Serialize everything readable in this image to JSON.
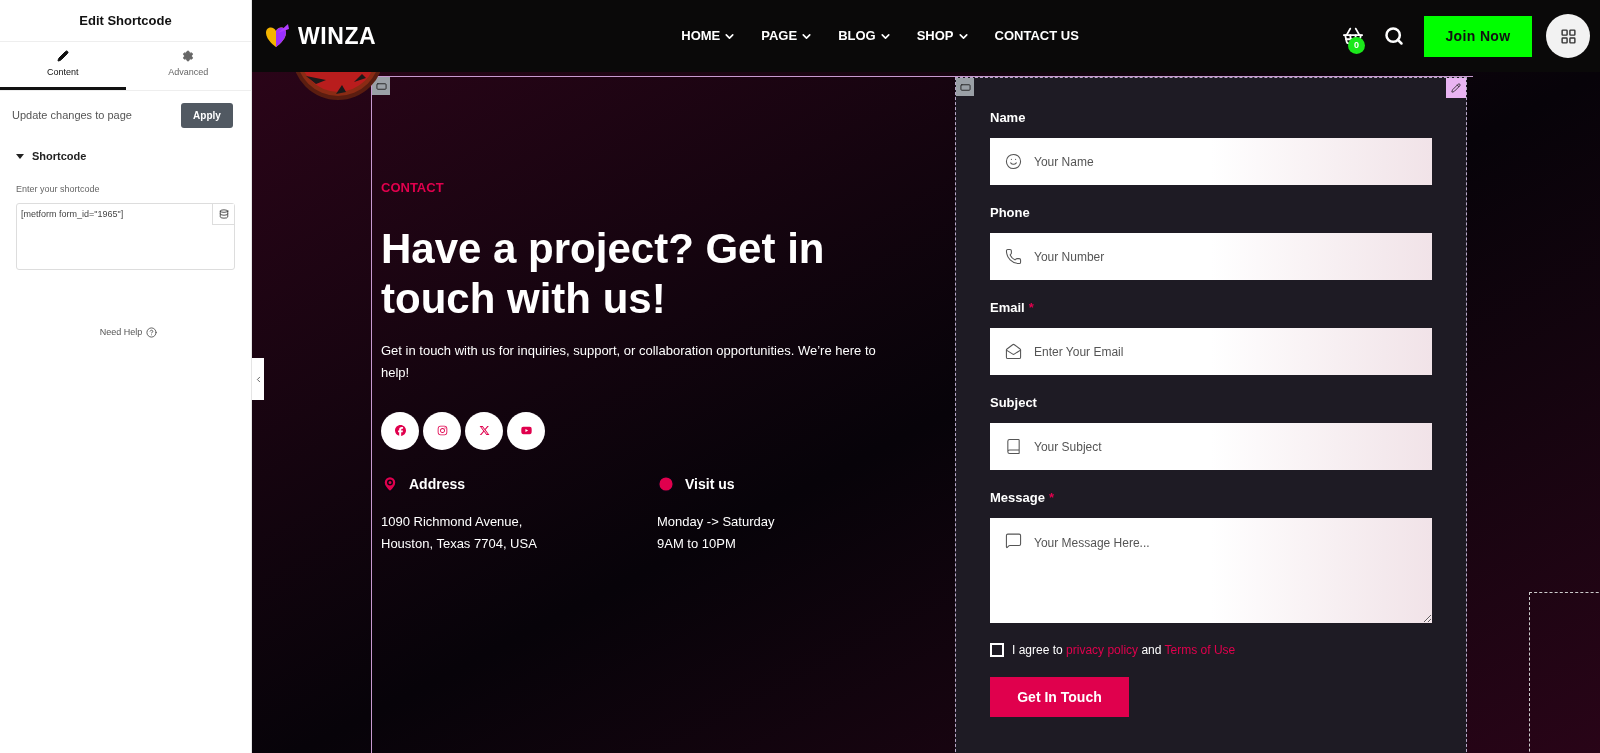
{
  "panel": {
    "title": "Edit Shortcode",
    "tabs": [
      {
        "label": "Content",
        "selected": true
      },
      {
        "label": "Advanced",
        "selected": false
      }
    ],
    "update_label": "Update changes to page",
    "apply_button": "Apply",
    "section": {
      "title": "Shortcode",
      "expanded": true,
      "field_label": "Enter your shortcode",
      "value": "[metform form_id=\"1965\"]"
    },
    "help": "Need Help"
  },
  "header": {
    "logo": "WINZA",
    "nav": [
      {
        "label": "HOME",
        "has_menu": true
      },
      {
        "label": "PAGE",
        "has_menu": true
      },
      {
        "label": "BLOG",
        "has_menu": true
      },
      {
        "label": "SHOP",
        "has_menu": true
      },
      {
        "label": "CONTACT US",
        "has_menu": false
      }
    ],
    "cart_count": "0",
    "join_button": "Join Now"
  },
  "contact": {
    "eyebrow": "CONTACT",
    "heading": "Have a project? Get in touch with us!",
    "text": "Get in touch with us for inquiries, support, or collaboration opportunities. We’re here to help!",
    "info": [
      {
        "title": "Address",
        "lines": [
          "1090 Richmond Avenue,",
          "Houston, Texas 7704, USA"
        ]
      },
      {
        "title": "Visit us",
        "lines": [
          "Monday -> Saturday",
          "9AM to 10PM"
        ]
      }
    ]
  },
  "form": {
    "fields": [
      {
        "label": "Name",
        "required": false,
        "kind": "input",
        "placeholder": "Your Name"
      },
      {
        "label": "Phone",
        "required": false,
        "kind": "input",
        "placeholder": "Your Number"
      },
      {
        "label": "Email",
        "required": true,
        "kind": "input",
        "placeholder": "Enter Your Email"
      },
      {
        "label": "Subject",
        "required": false,
        "kind": "input",
        "placeholder": "Your Subject"
      },
      {
        "label": "Message",
        "required": true,
        "kind": "textarea",
        "placeholder": "Your Message Here..."
      }
    ],
    "required_mark": "*",
    "agreement": {
      "checked": false,
      "parts": [
        {
          "kind": "plain",
          "text": "I agree to"
        },
        {
          "kind": "link",
          "text": "privacy policy"
        },
        {
          "kind": "plain",
          "text": "and"
        },
        {
          "kind": "link",
          "text": "Terms of Use"
        }
      ]
    },
    "submit": "Get In Touch"
  }
}
